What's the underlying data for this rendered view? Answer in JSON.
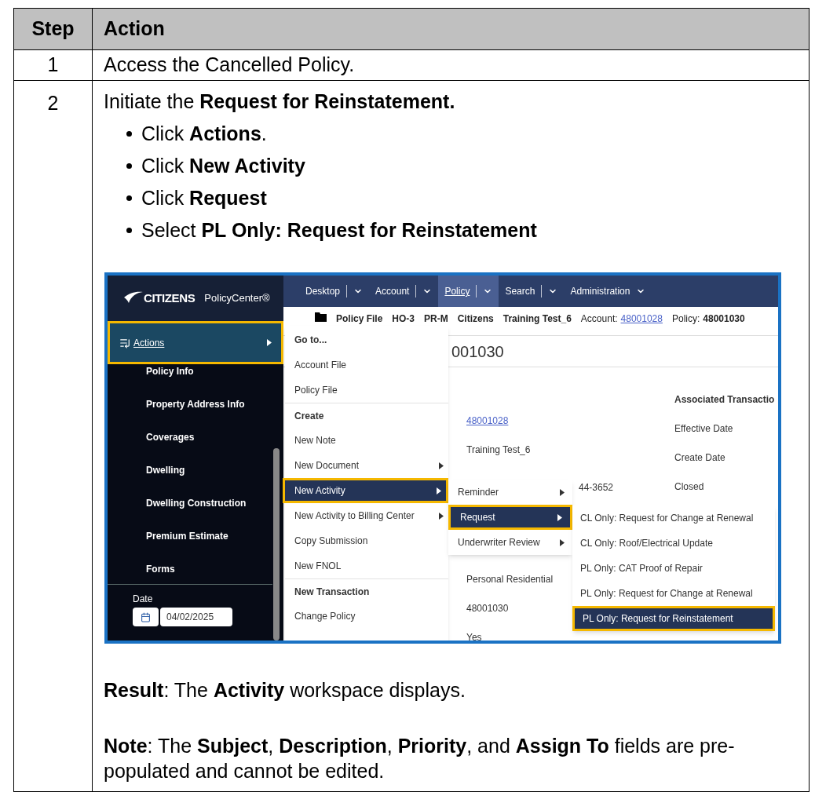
{
  "table": {
    "columns": [
      "Step",
      "Action"
    ],
    "rows": [
      {
        "step": "1",
        "text": "Access the Cancelled Policy."
      },
      {
        "step": "2",
        "intro": "Initiate the **Request for Reinstatement.**",
        "bullets": [
          "Click **Actions**.",
          "Click **New Activity**",
          "Click **Request**",
          "Select **PL Only: Request for Reinstatement**"
        ],
        "screenshot": {
          "logo": {
            "brand": "CITIZENS",
            "product": "PolicyCenter®"
          },
          "sidebar": {
            "actions": {
              "label": "Actions",
              "expanded": true
            },
            "items": [
              "Policy Info",
              "Property Address Info",
              "Coverages",
              "Dwelling",
              "Dwelling Construction",
              "Premium Estimate",
              "Forms"
            ],
            "date_label": "Date",
            "date_value": "04/02/2025"
          },
          "nav": [
            {
              "label": "Desktop",
              "selected": false,
              "separator": true
            },
            {
              "label": "Account",
              "selected": false,
              "separator": true
            },
            {
              "label": "Policy",
              "selected": true,
              "separator": true
            },
            {
              "label": "Search",
              "selected": false,
              "separator": true
            },
            {
              "label": "Administration",
              "selected": false,
              "separator": false
            }
          ],
          "info_bar": {
            "items": [
              "Policy File",
              "HO-3",
              "PR-M",
              "Citizens",
              "Training Test_6"
            ],
            "account_label": "Account:",
            "account": "48001028",
            "policy_label": "Policy:",
            "policy": "48001030"
          },
          "title": "001030",
          "left_fields": [
            {
              "text": "48001028",
              "kind": "link"
            },
            {
              "text": "Training Test_6",
              "kind": "text"
            },
            {
              "text": "44-3652",
              "kind": "text"
            },
            {
              "text": "Personal Residential",
              "kind": "text"
            },
            {
              "text": "48001030",
              "kind": "text"
            },
            {
              "text": "Yes",
              "kind": "text"
            }
          ],
          "right_fields": [
            {
              "text": "Associated Transactio",
              "kind": "heading"
            },
            {
              "text": "Effective Date",
              "kind": "text"
            },
            {
              "text": "Create Date",
              "kind": "text"
            },
            {
              "text": "Closed",
              "kind": "text"
            }
          ],
          "menu": [
            {
              "label": "Go to...",
              "kind": "header",
              "submenu": false,
              "selected": false
            },
            {
              "label": "Account File",
              "kind": "item",
              "submenu": false,
              "selected": false
            },
            {
              "label": "Policy File",
              "kind": "item",
              "submenu": false,
              "selected": false
            },
            {
              "label": "Create",
              "kind": "header",
              "submenu": false,
              "selected": false
            },
            {
              "label": "New Note",
              "kind": "item",
              "submenu": false,
              "selected": false
            },
            {
              "label": "New Document",
              "kind": "item",
              "submenu": true,
              "selected": false
            },
            {
              "label": "New Activity",
              "kind": "item",
              "submenu": true,
              "selected": true
            },
            {
              "label": "New Activity to Billing Center",
              "kind": "item",
              "submenu": true,
              "selected": false
            },
            {
              "label": "Copy Submission",
              "kind": "item",
              "submenu": false,
              "selected": false
            },
            {
              "label": "New FNOL",
              "kind": "item",
              "submenu": false,
              "selected": false
            },
            {
              "label": "New Transaction",
              "kind": "header",
              "submenu": false,
              "selected": false
            },
            {
              "label": "Change Policy",
              "kind": "item",
              "submenu": false,
              "selected": false
            }
          ],
          "submenu": [
            {
              "label": "Reminder",
              "submenu": true,
              "selected": false
            },
            {
              "label": "Request",
              "submenu": true,
              "selected": true
            },
            {
              "label": "Underwriter Review",
              "submenu": true,
              "selected": false
            }
          ],
          "request_menu": [
            {
              "label": "CL Only: Request for Change at Renewal",
              "selected": false
            },
            {
              "label": "CL Only: Roof/Electrical Update",
              "selected": false
            },
            {
              "label": "PL Only: CAT Proof of Repair",
              "selected": false
            },
            {
              "label": "PL Only: Request for Change at Renewal",
              "selected": false
            },
            {
              "label": "PL Only: Request for Reinstatement",
              "selected": true
            }
          ]
        },
        "result": "**Result**: The **Activity** workspace displays.",
        "note": "**Note**: The **Subject**, **Description**, **Priority**, and **Assign To** fields are pre-populated and cannot be edited."
      }
    ]
  }
}
